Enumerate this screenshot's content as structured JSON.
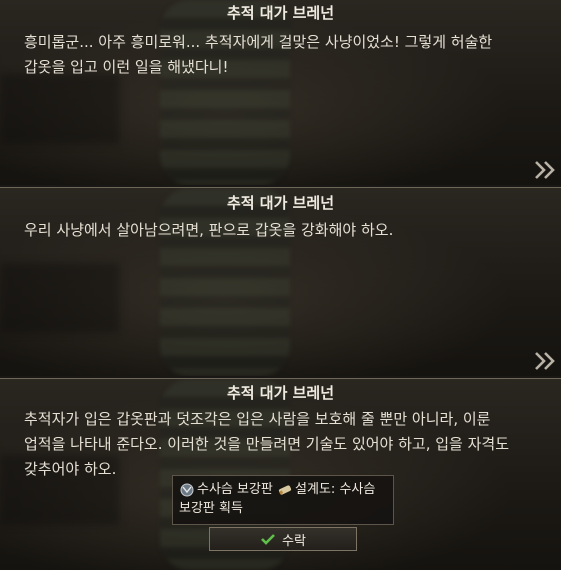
{
  "dialogs": [
    {
      "speaker": "추적 대가 브레넌",
      "text": "흥미롭군... 아주 흥미로워... 추적자에게 걸맞은 사냥이었소! 그렇게 허술한\n갑옷을 입고 이런 일을 해냈다니!",
      "next_icon": "double-chevron-right"
    },
    {
      "speaker": "추적 대가 브레넌",
      "text": "우리 사냥에서 살아남으려면, 판으로 갑옷을 강화해야 하오.",
      "next_icon": "double-chevron-right"
    },
    {
      "speaker": "추적 대가 브레넌",
      "text": "추적자가 입은 갑옷판과 덧조각은 입은 사람을 보호해 줄 뿐만 아니라, 이룬\n업적을 나타내 준다오. 이러한 것을 만들려면 기술도 있어야 하고, 입을 자격도\n갖추어야 하오."
    }
  ],
  "reward": {
    "item1": "수사슴 보강판",
    "item2_prefix": "설계도: 수사슴",
    "item2_suffix": "보강판 획득"
  },
  "accept_button": {
    "label": "수락"
  },
  "colors": {
    "accept_check": "#5fbf4a",
    "panel_border": "#6f665a"
  }
}
